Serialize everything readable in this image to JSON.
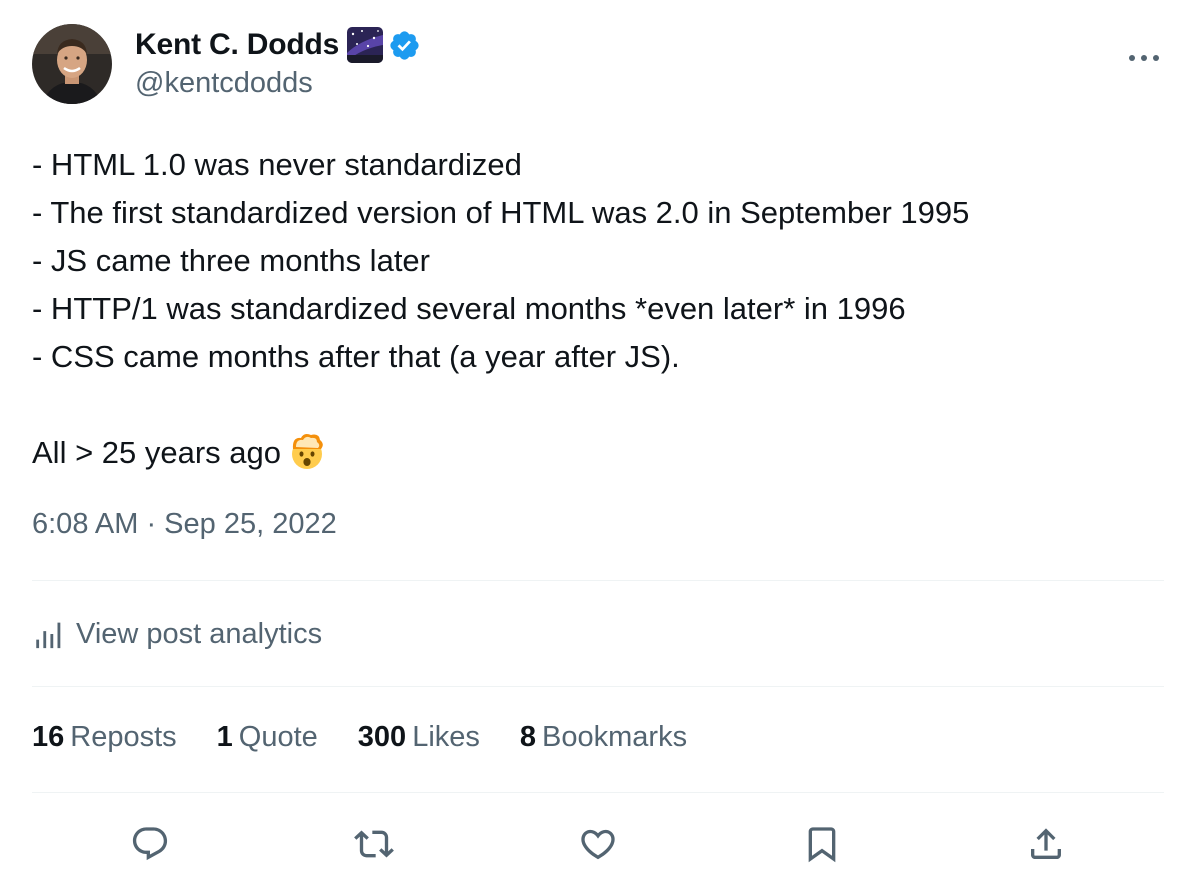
{
  "author": {
    "name": "Kent C. Dodds",
    "handle": "@kentcdodds",
    "verified": true
  },
  "tweet": {
    "lines": [
      "- HTML 1.0 was never standardized",
      "- The first standardized version of HTML was 2.0 in September 1995",
      "- JS came three months later",
      "- HTTP/1 was standardized several months *even later* in 1996",
      "- CSS came months after that (a year after JS)."
    ],
    "closing": "All > 25 years ago",
    "closing_emoji": "exploding-head-icon"
  },
  "timestamp": "6:08 AM · Sep 25, 2022",
  "analytics": {
    "label": "View post analytics"
  },
  "stats": [
    {
      "count": "16",
      "label": "Reposts"
    },
    {
      "count": "1",
      "label": "Quote"
    },
    {
      "count": "300",
      "label": "Likes"
    },
    {
      "count": "8",
      "label": "Bookmarks"
    }
  ],
  "actions": [
    "reply-icon",
    "repost-icon",
    "like-icon",
    "bookmark-icon",
    "share-icon"
  ],
  "colors": {
    "text": "#0f1419",
    "secondary": "#536471",
    "divider": "#eff3f4",
    "verified": "#1d9bf0"
  }
}
